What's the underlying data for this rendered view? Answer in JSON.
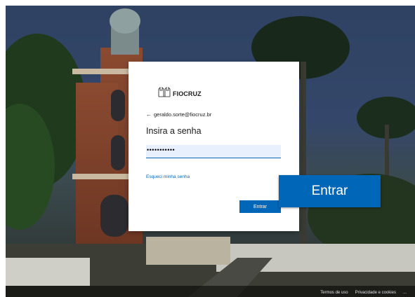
{
  "login": {
    "brand": "FIOCRUZ",
    "email": "geraldo.sorte@fiocruz.br",
    "title": "Insira a senha",
    "password_masked": "•••••••••••",
    "forgot_link": "Esqueci minha senha",
    "submit_label": "Entrar"
  },
  "callout": {
    "label": "Entrar"
  },
  "footer": {
    "terms": "Termos de uso",
    "privacy": "Privacidade e cookies",
    "more": "..."
  },
  "colors": {
    "accent": "#0067b8",
    "input_bg": "#e8f0fe",
    "card_bg": "#ffffff"
  },
  "icons": {
    "back": "back-arrow-icon",
    "logo": "fiocruz-logo-icon"
  }
}
